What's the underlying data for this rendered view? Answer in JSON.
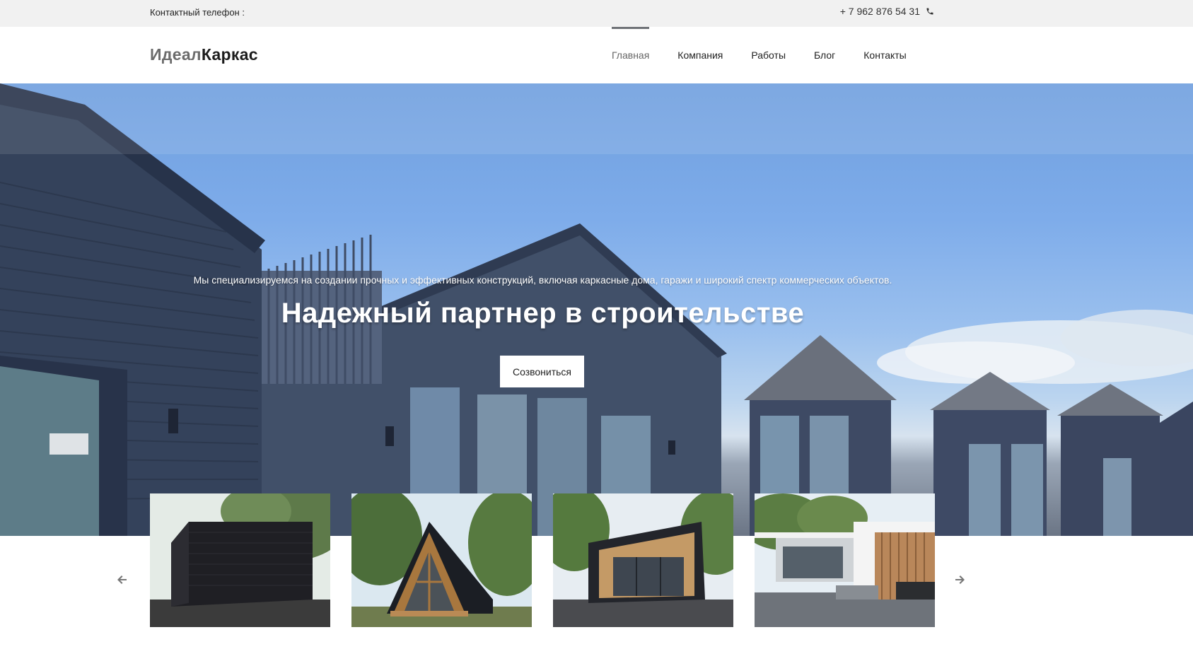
{
  "topbar": {
    "contact_label": "Контактный телефон :",
    "phone": "+ 7 962 876 54 31",
    "phone_icon": "phone-icon"
  },
  "header": {
    "logo_part1": "Идеал",
    "logo_part2": "Каркас",
    "nav": [
      {
        "label": "Главная",
        "active": true
      },
      {
        "label": "Компания",
        "active": false
      },
      {
        "label": "Работы",
        "active": false
      },
      {
        "label": "Блог",
        "active": false
      },
      {
        "label": "Контакты",
        "active": false
      }
    ]
  },
  "hero": {
    "subtitle": "Мы специализируемся на создании прочных и эффективных конструкций, включая каркасные дома, гаражи и широкий спектр коммерческих объектов.",
    "title": "Надежный партнер в строительстве",
    "button_label": "Созвониться"
  },
  "carousel": {
    "prev_icon": "arrow-left-icon",
    "next_icon": "arrow-right-icon",
    "items": [
      "garage-image",
      "a-frame-house-image",
      "cabin-image",
      "modern-house-image"
    ]
  },
  "colors": {
    "topbar_bg": "#f1f1f1",
    "active_nav_indicator": "#6f7277",
    "facade": "#3d4a63",
    "sky": "#7eacea"
  }
}
